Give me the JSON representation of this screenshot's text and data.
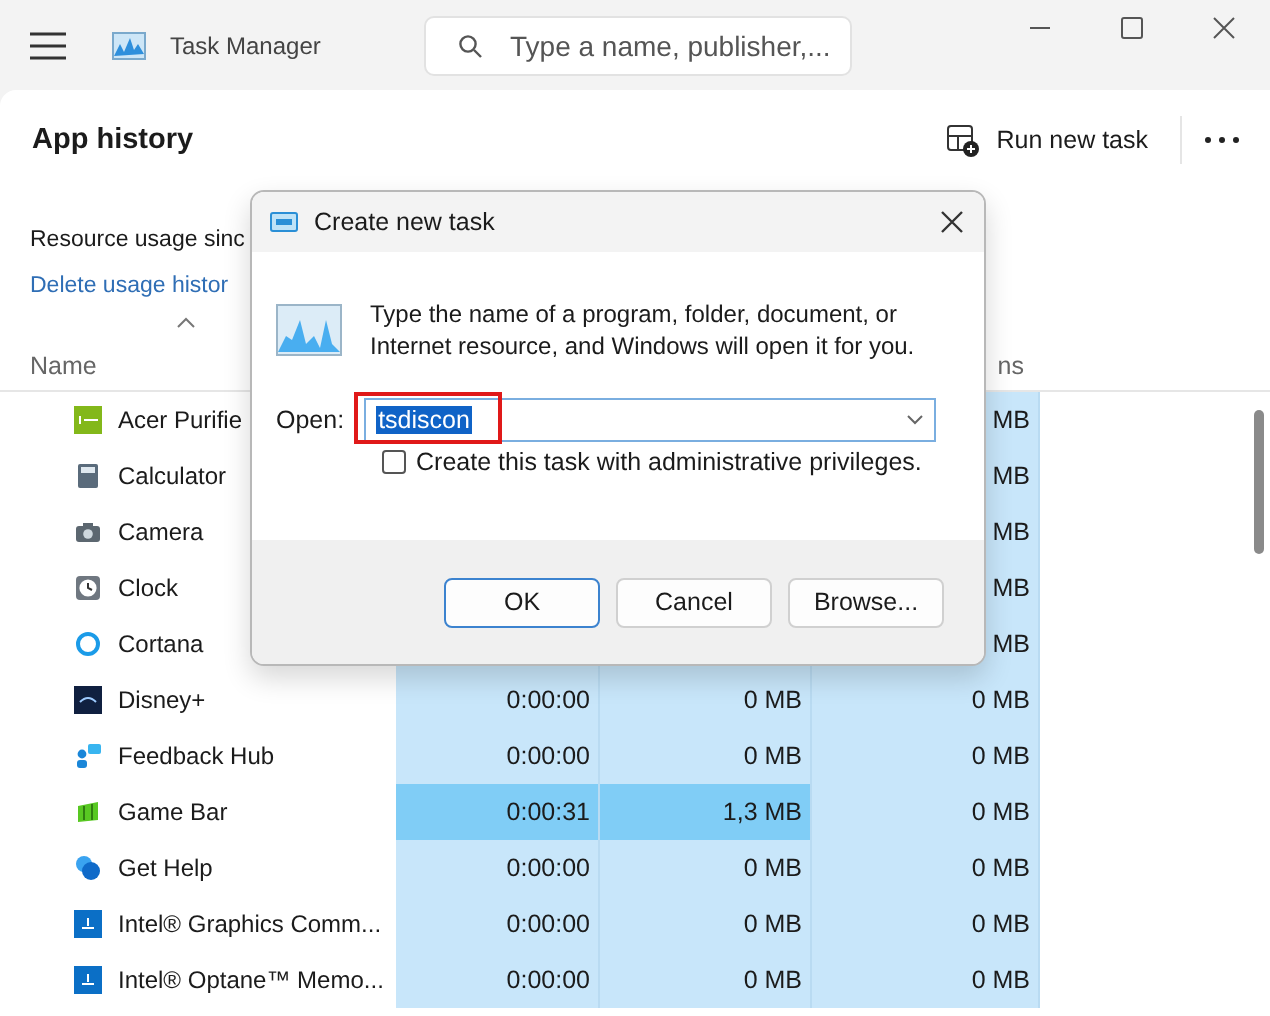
{
  "window": {
    "title": "Task Manager"
  },
  "search": {
    "placeholder": "Type a name, publisher,..."
  },
  "page": {
    "title": "App history",
    "run_task": "Run new task"
  },
  "info": {
    "text": "Resource usage sinc",
    "link": "Delete usage histor"
  },
  "table": {
    "columns": [
      {
        "label": "Name"
      },
      {},
      {},
      {
        "label": "ns"
      }
    ],
    "rows": [
      {
        "name": "Acer Purifie",
        "cells": [
          {},
          {},
          {
            "text": "MB",
            "intense": false
          }
        ]
      },
      {
        "name": "Calculator",
        "cells": [
          {},
          {},
          {
            "text": "MB",
            "intense": false
          }
        ]
      },
      {
        "name": "Camera",
        "cells": [
          {},
          {},
          {
            "text": "MB",
            "intense": false
          }
        ]
      },
      {
        "name": "Clock",
        "cells": [
          {},
          {},
          {
            "text": "MB",
            "intense": false
          }
        ]
      },
      {
        "name": "Cortana",
        "cells": [
          {},
          {},
          {
            "text": "MB",
            "intense": false
          }
        ]
      },
      {
        "name": "Disney+",
        "cells": [
          {
            "text": "0:00:00",
            "intense": false
          },
          {
            "text": "0 MB",
            "intense": false
          },
          {
            "text": "0 MB",
            "intense": false
          }
        ]
      },
      {
        "name": "Feedback Hub",
        "cells": [
          {
            "text": "0:00:00",
            "intense": false
          },
          {
            "text": "0 MB",
            "intense": false
          },
          {
            "text": "0 MB",
            "intense": false
          }
        ]
      },
      {
        "name": "Game Bar",
        "cells": [
          {
            "text": "0:00:31",
            "intense": true
          },
          {
            "text": "1,3 MB",
            "intense": true
          },
          {
            "text": "0 MB",
            "intense": false
          }
        ]
      },
      {
        "name": "Get Help",
        "cells": [
          {
            "text": "0:00:00",
            "intense": false
          },
          {
            "text": "0 MB",
            "intense": false
          },
          {
            "text": "0 MB",
            "intense": false
          }
        ]
      },
      {
        "name": "Intel® Graphics Comm...",
        "cells": [
          {
            "text": "0:00:00",
            "intense": false
          },
          {
            "text": "0 MB",
            "intense": false
          },
          {
            "text": "0 MB",
            "intense": false
          }
        ]
      },
      {
        "name": "Intel® Optane™ Memo...",
        "cells": [
          {
            "text": "0:00:00",
            "intense": false
          },
          {
            "text": "0 MB",
            "intense": false
          },
          {
            "text": "0 MB",
            "intense": false
          }
        ]
      }
    ]
  },
  "dialog": {
    "title": "Create new task",
    "message": "Type the name of a program, folder, document, or Internet resource, and Windows will open it for you.",
    "open_label": "Open:",
    "open_value": "tsdiscon",
    "admin_label": "Create this task with administrative privileges.",
    "admin_checked": false,
    "buttons": [
      {
        "label": "OK",
        "selected": true
      },
      {
        "label": "Cancel",
        "selected": false
      },
      {
        "label": "Browse...",
        "selected": false
      }
    ]
  }
}
